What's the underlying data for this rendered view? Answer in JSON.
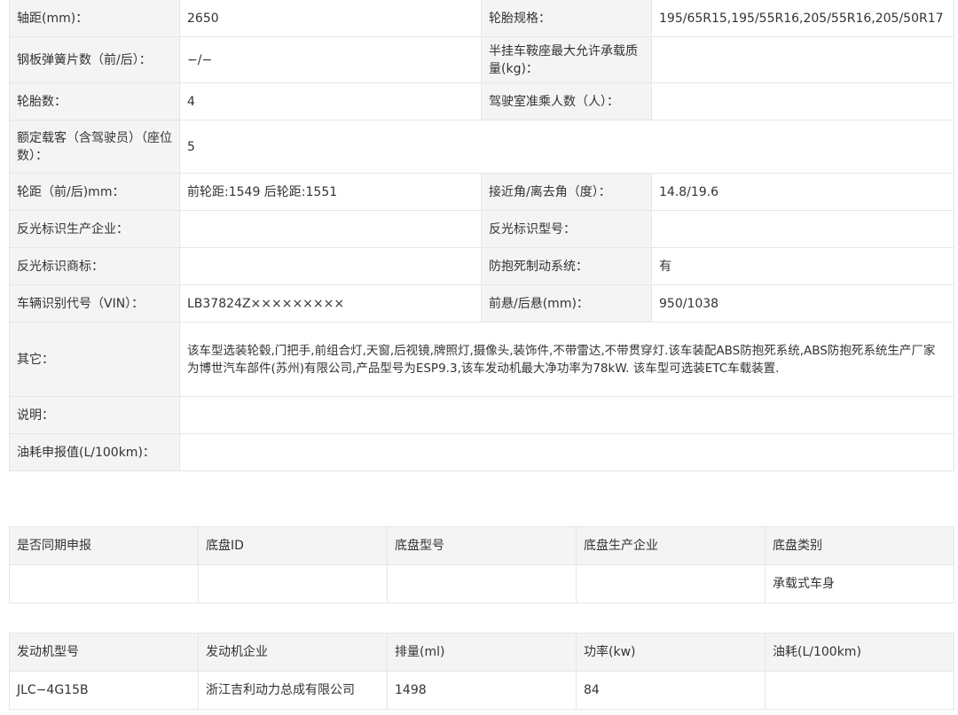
{
  "spec": {
    "rows": [
      {
        "k1": "轴距(mm)：",
        "v1": "2650",
        "k2": "轮胎规格：",
        "v2": "195/65R15,195/55R16,205/55R16,205/50R17"
      },
      {
        "k1": "钢板弹簧片数（前/后）：",
        "v1": "−/−",
        "k2": "半挂车鞍座最大允许承载质量(kg)：",
        "v2": ""
      },
      {
        "k1": "轮胎数：",
        "v1": "4",
        "k2": "驾驶室准乘人数（人）：",
        "v2": ""
      },
      {
        "k1": "额定载客（含驾驶员）（座位数）：",
        "v1": "5"
      },
      {
        "k1": "轮距（前/后)mm：",
        "v1": "前轮距:1549 后轮距:1551",
        "k2": "接近角/离去角（度）：",
        "v2": "14.8/19.6"
      },
      {
        "k1": "反光标识生产企业：",
        "v1": "",
        "k2": "反光标识型号：",
        "v2": ""
      },
      {
        "k1": "反光标识商标：",
        "v1": "",
        "k2": "防抱死制动系统：",
        "v2": "有"
      },
      {
        "k1": "车辆识别代号（VIN）：",
        "v1": "LB37824Z×××××××××",
        "k2": "前悬/后悬(mm)：",
        "v2": "950/1038"
      },
      {
        "k1": "其它：",
        "v1": "该车型选装轮毂,门把手,前组合灯,天窗,后视镜,牌照灯,摄像头,装饰件,不带雷达,不带贯穿灯.该车装配ABS防抱死系统,ABS防抱死系统生产厂家为博世汽车部件(苏州)有限公司,产品型号为ESP9.3,该车发动机最大净功率为78kW. 该车型可选装ETC车载装置."
      },
      {
        "k1": "说明：",
        "v1": ""
      },
      {
        "k1": "油耗申报值(L/100km)：",
        "v1": ""
      }
    ]
  },
  "chassis": {
    "headers": [
      "是否同期申报",
      "底盘ID",
      "底盘型号",
      "底盘生产企业",
      "底盘类别"
    ],
    "row": [
      "",
      "",
      "",
      "",
      "承载式车身"
    ]
  },
  "engine": {
    "headers": [
      "发动机型号",
      "发动机企业",
      "排量(ml)",
      "功率(kw)",
      "油耗(L/100km)"
    ],
    "row": [
      "JLC−4G15B",
      "浙江吉利动力总成有限公司",
      "1498",
      "84",
      ""
    ]
  }
}
